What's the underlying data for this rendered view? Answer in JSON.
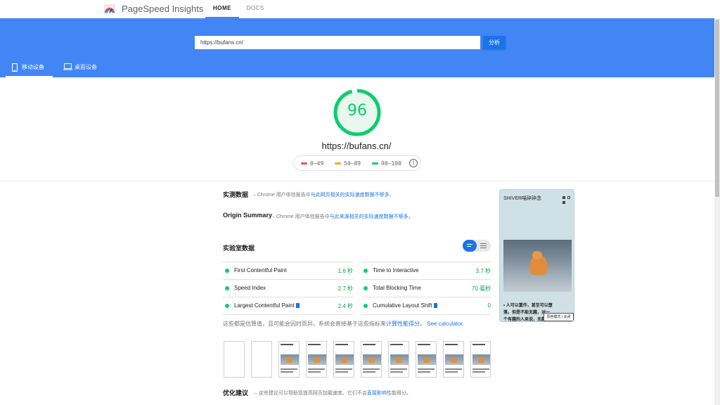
{
  "topbar": {
    "brand": "PageSpeed Insights",
    "nav_home": "HOME",
    "nav_docs": "DOCS"
  },
  "search": {
    "url_value": "https://bufans.cn/",
    "analyze_label": "分析"
  },
  "tabs": [
    {
      "label": "移动设备",
      "icon": "mobile-icon",
      "active": true
    },
    {
      "label": "桌面设备",
      "icon": "desktop-icon",
      "active": false
    }
  ],
  "score": {
    "value": "96",
    "fraction": 0.96,
    "color": "#0cce6b",
    "tested_url": "https://bufans.cn/"
  },
  "legend": {
    "poor": "0–49",
    "average": "50–89",
    "good": "90–100",
    "poor_color": "#ff4e42",
    "average_color": "#ffa400",
    "good_color": "#0cce6b"
  },
  "field_data": {
    "title": "实测数据",
    "desc_prefix": "– Chrome 用户体验报告中",
    "desc_link": "与此网页相关的实际速度数据不够多",
    "desc_suffix": "。"
  },
  "origin_summary": {
    "title": "Origin Summary",
    "desc_prefix": "– Chrome 用户体验报告中",
    "desc_link": "与此来源相关的实际速度数据不够多",
    "desc_suffix": "。"
  },
  "lab_data": {
    "title": "实验室数据",
    "metrics": [
      {
        "name": "First Contentful Paint",
        "value": "1.6 秒"
      },
      {
        "name": "Time to Interactive",
        "value": "3.7 秒"
      },
      {
        "name": "Speed Index",
        "value": "2.7 秒"
      },
      {
        "name": "Total Blocking Time",
        "value": "70 毫秒"
      },
      {
        "name": "Largest Contentful Paint",
        "value": "2.4 秒"
      },
      {
        "name": "Cumulative Layout Shift",
        "value": "0"
      }
    ],
    "note_prefix": "这些都是估算值，且可能会因时而异。系统会直接基于这些指标来",
    "note_link1": "计算性能得分",
    "note_middle": "。",
    "note_link2": "See calculator."
  },
  "optimization": {
    "title": "优化建议",
    "desc_prefix": "– 这些建议可以帮助您提高网页加载速度。它们不会",
    "desc_link": "直接影响",
    "desc_suffix": "性能得分。"
  },
  "thumbnail": {
    "title": "SHIVER喵碎碎念",
    "text": "• 人可以重作，甚至可以堕落，但是不能无趣，对一个有趣的人来说，无趣大概是最致命的",
    "badge": "原色模式 | 关闭"
  }
}
